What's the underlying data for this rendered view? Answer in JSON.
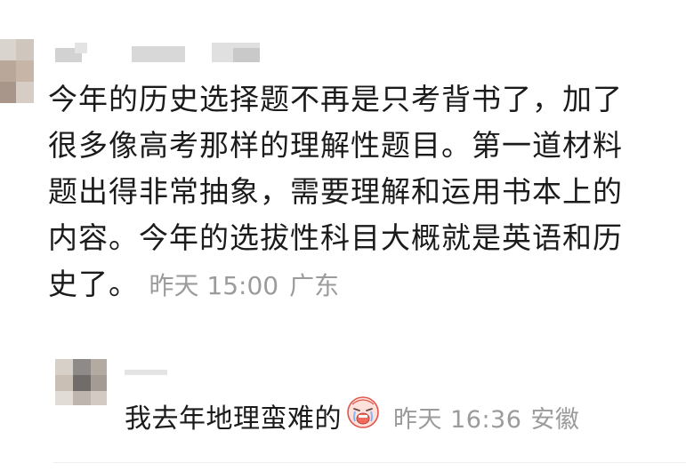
{
  "comment": {
    "lines": [
      "今年的历史选择题不再是只考背书了，加了",
      "很多像高考那样的理解性题目。第一道材料",
      "题出得非常抽象，需要理解和运用书本上的",
      "内容。今年的选拔性科目大概就是英语和历",
      "史了。"
    ],
    "time": "昨天 15:00",
    "location": "广东"
  },
  "reply": {
    "text": "我去年地理蛮难的",
    "emoji_icon": "crying-face-icon",
    "time": "昨天 16:36",
    "location": "安徽"
  },
  "colors": {
    "text": "#1b1b1b",
    "meta": "#9b9b9b",
    "emoji_red": "#f06a5e"
  }
}
